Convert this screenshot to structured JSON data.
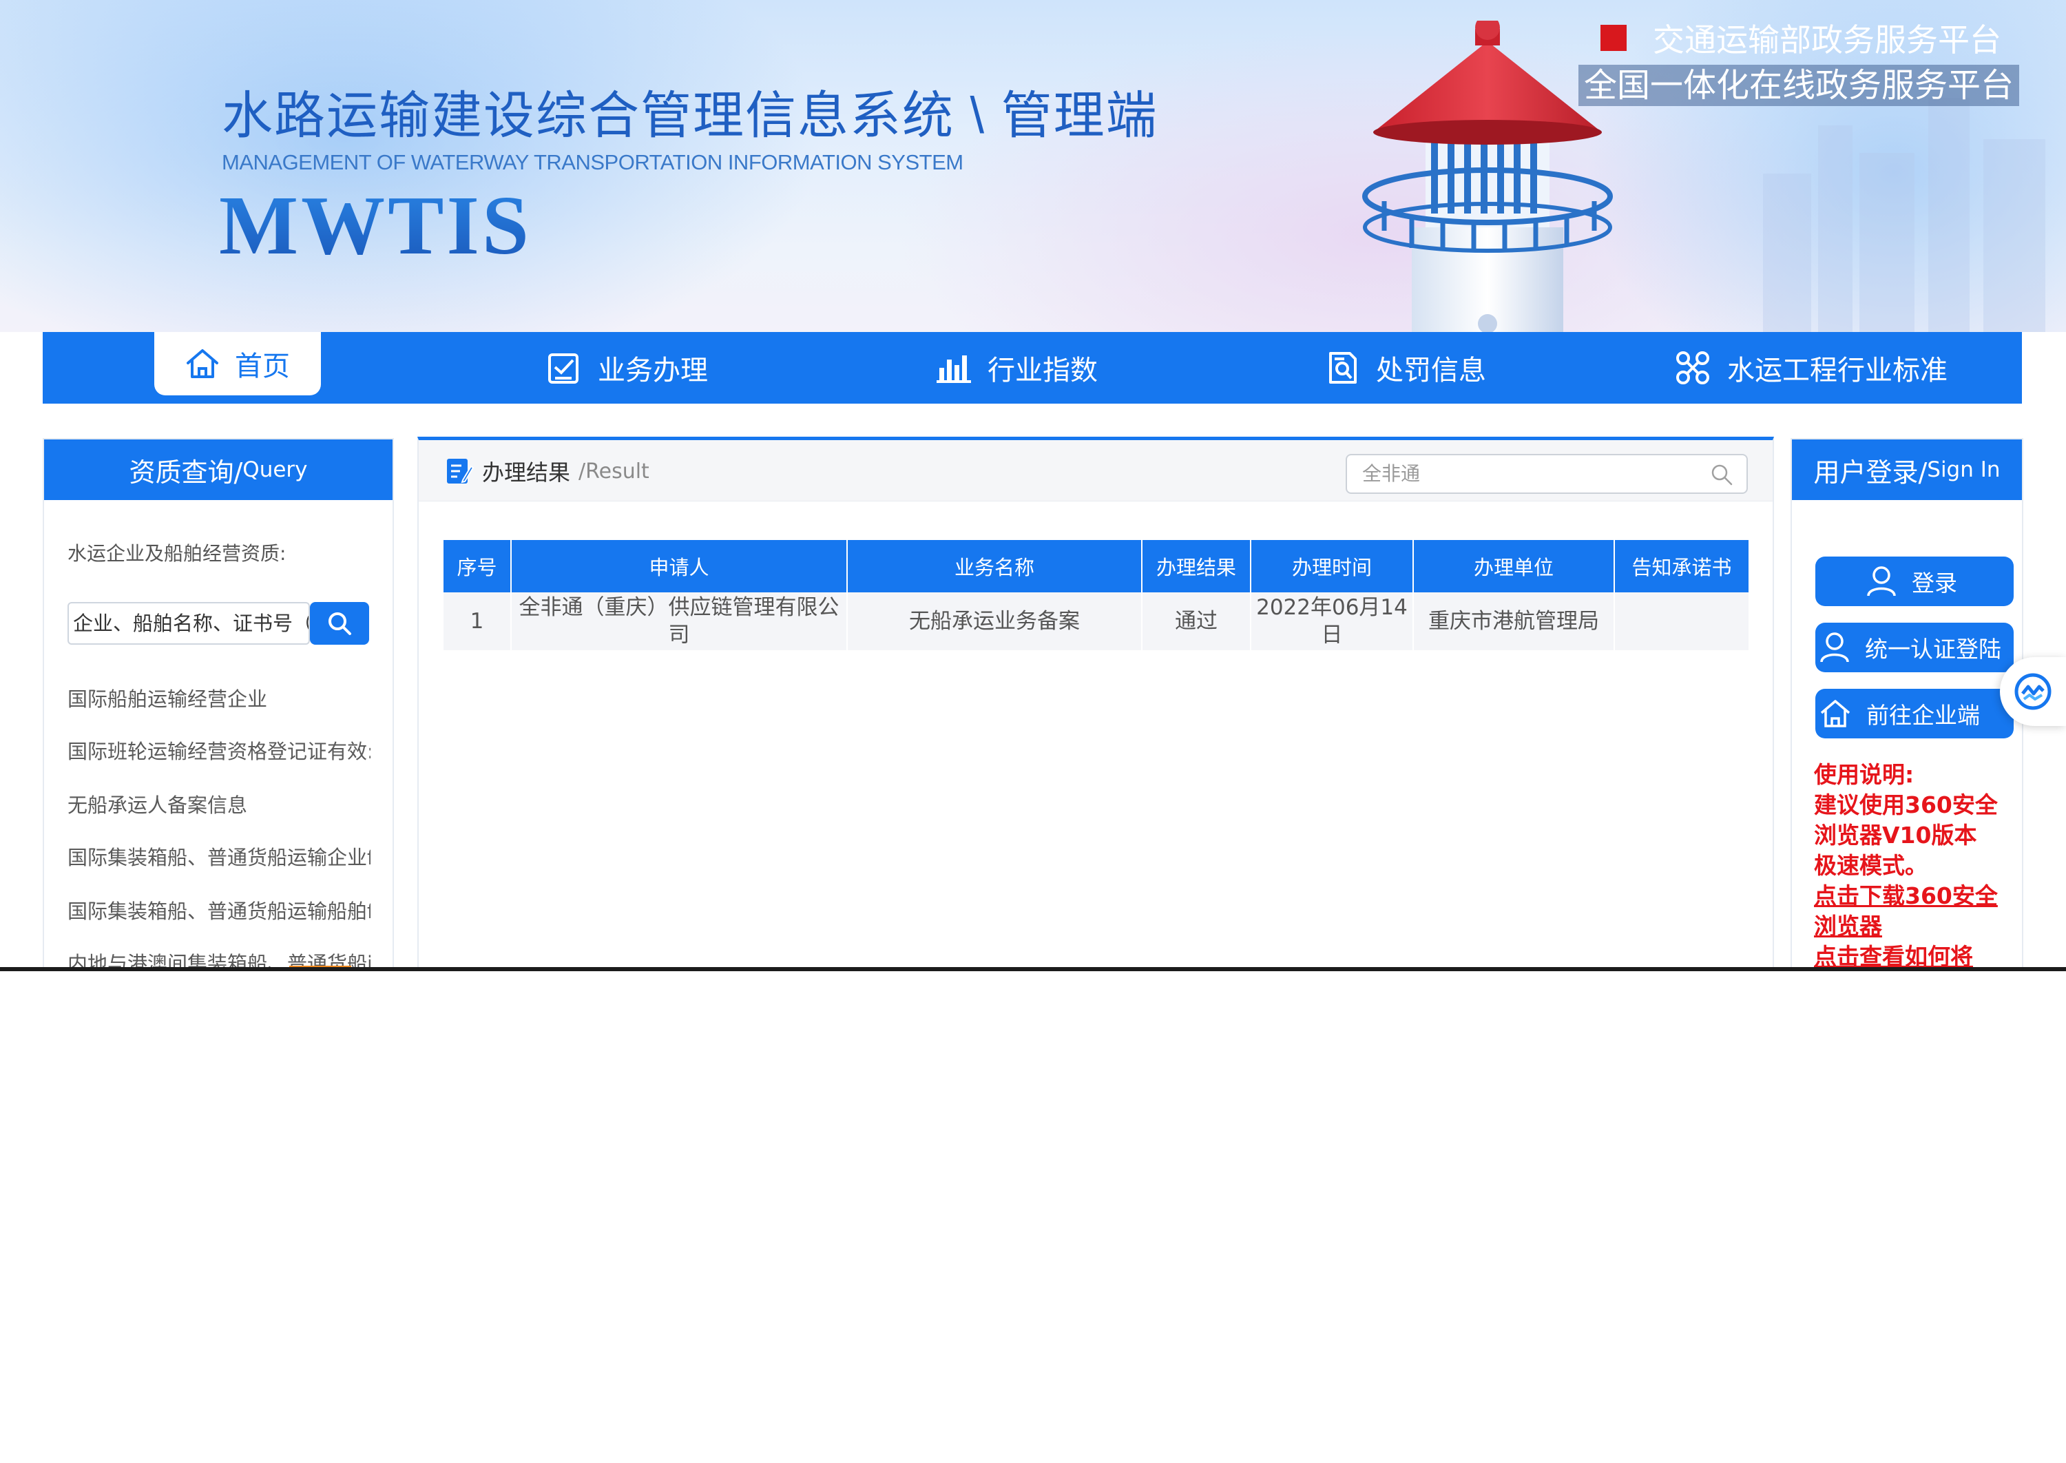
{
  "header": {
    "system_title": "水路运输建设综合管理信息系统 \\ 管理端",
    "system_subtitle": "MANAGEMENT OF WATERWAY TRANSPORTATION INFORMATION SYSTEM",
    "system_abbr": "MWTIS",
    "platform_line1": "交通运输部政务服务平台",
    "platform_line2": "全国一体化在线政务服务平台"
  },
  "nav": {
    "items": [
      {
        "label": "首页",
        "icon": "home-icon",
        "active": true
      },
      {
        "label": "业务办理",
        "icon": "checklist-icon"
      },
      {
        "label": "行业指数",
        "icon": "bar-chart-icon"
      },
      {
        "label": "处罚信息",
        "icon": "document-search-icon"
      },
      {
        "label": "水运工程行业标准",
        "icon": "network-icon"
      }
    ]
  },
  "left_panel": {
    "title": "资质查询/",
    "title_en": "Query",
    "query_label": "水运企业及船舶经营资质:",
    "search_placeholder": "企业、船舶名称、证书号（",
    "links": [
      "国际船舶运输经营企业",
      "国际班轮运输经营资格登记证有效:",
      "无船承运人备案信息",
      "国际集装箱船、普通货船运输企业f",
      "国际集装箱船、普通货船运输船舶f",
      "内地与港澳间集装箱船、普通货船i"
    ]
  },
  "main": {
    "title": "办理结果",
    "title_en": "/Result",
    "search_value": "全非通",
    "table": {
      "headers": [
        "序号",
        "申请人",
        "业务名称",
        "办理结果",
        "办理时间",
        "办理单位",
        "告知承诺书"
      ],
      "rows": [
        [
          "1",
          "全非通（重庆）供应链管理有限公司",
          "无船承运业务备案",
          "通过",
          "2022年06月14日",
          "重庆市港航管理局",
          ""
        ]
      ]
    }
  },
  "right_panel": {
    "title": "用户登录/",
    "title_en": "Sign In",
    "buttons": [
      "登录",
      "统一认证登陆",
      "前往企业端"
    ],
    "note_title": "使用说明:",
    "note_lines": [
      "建议使用360安全",
      "浏览器V10版本",
      "极速模式。"
    ],
    "link_lines": [
      "点击下载360安全",
      "浏览器",
      "点击查看如何将"
    ]
  },
  "colors": {
    "primary": "#1677ef",
    "alert": "#e6151b",
    "lighthouse_roof": "#d8343f"
  }
}
